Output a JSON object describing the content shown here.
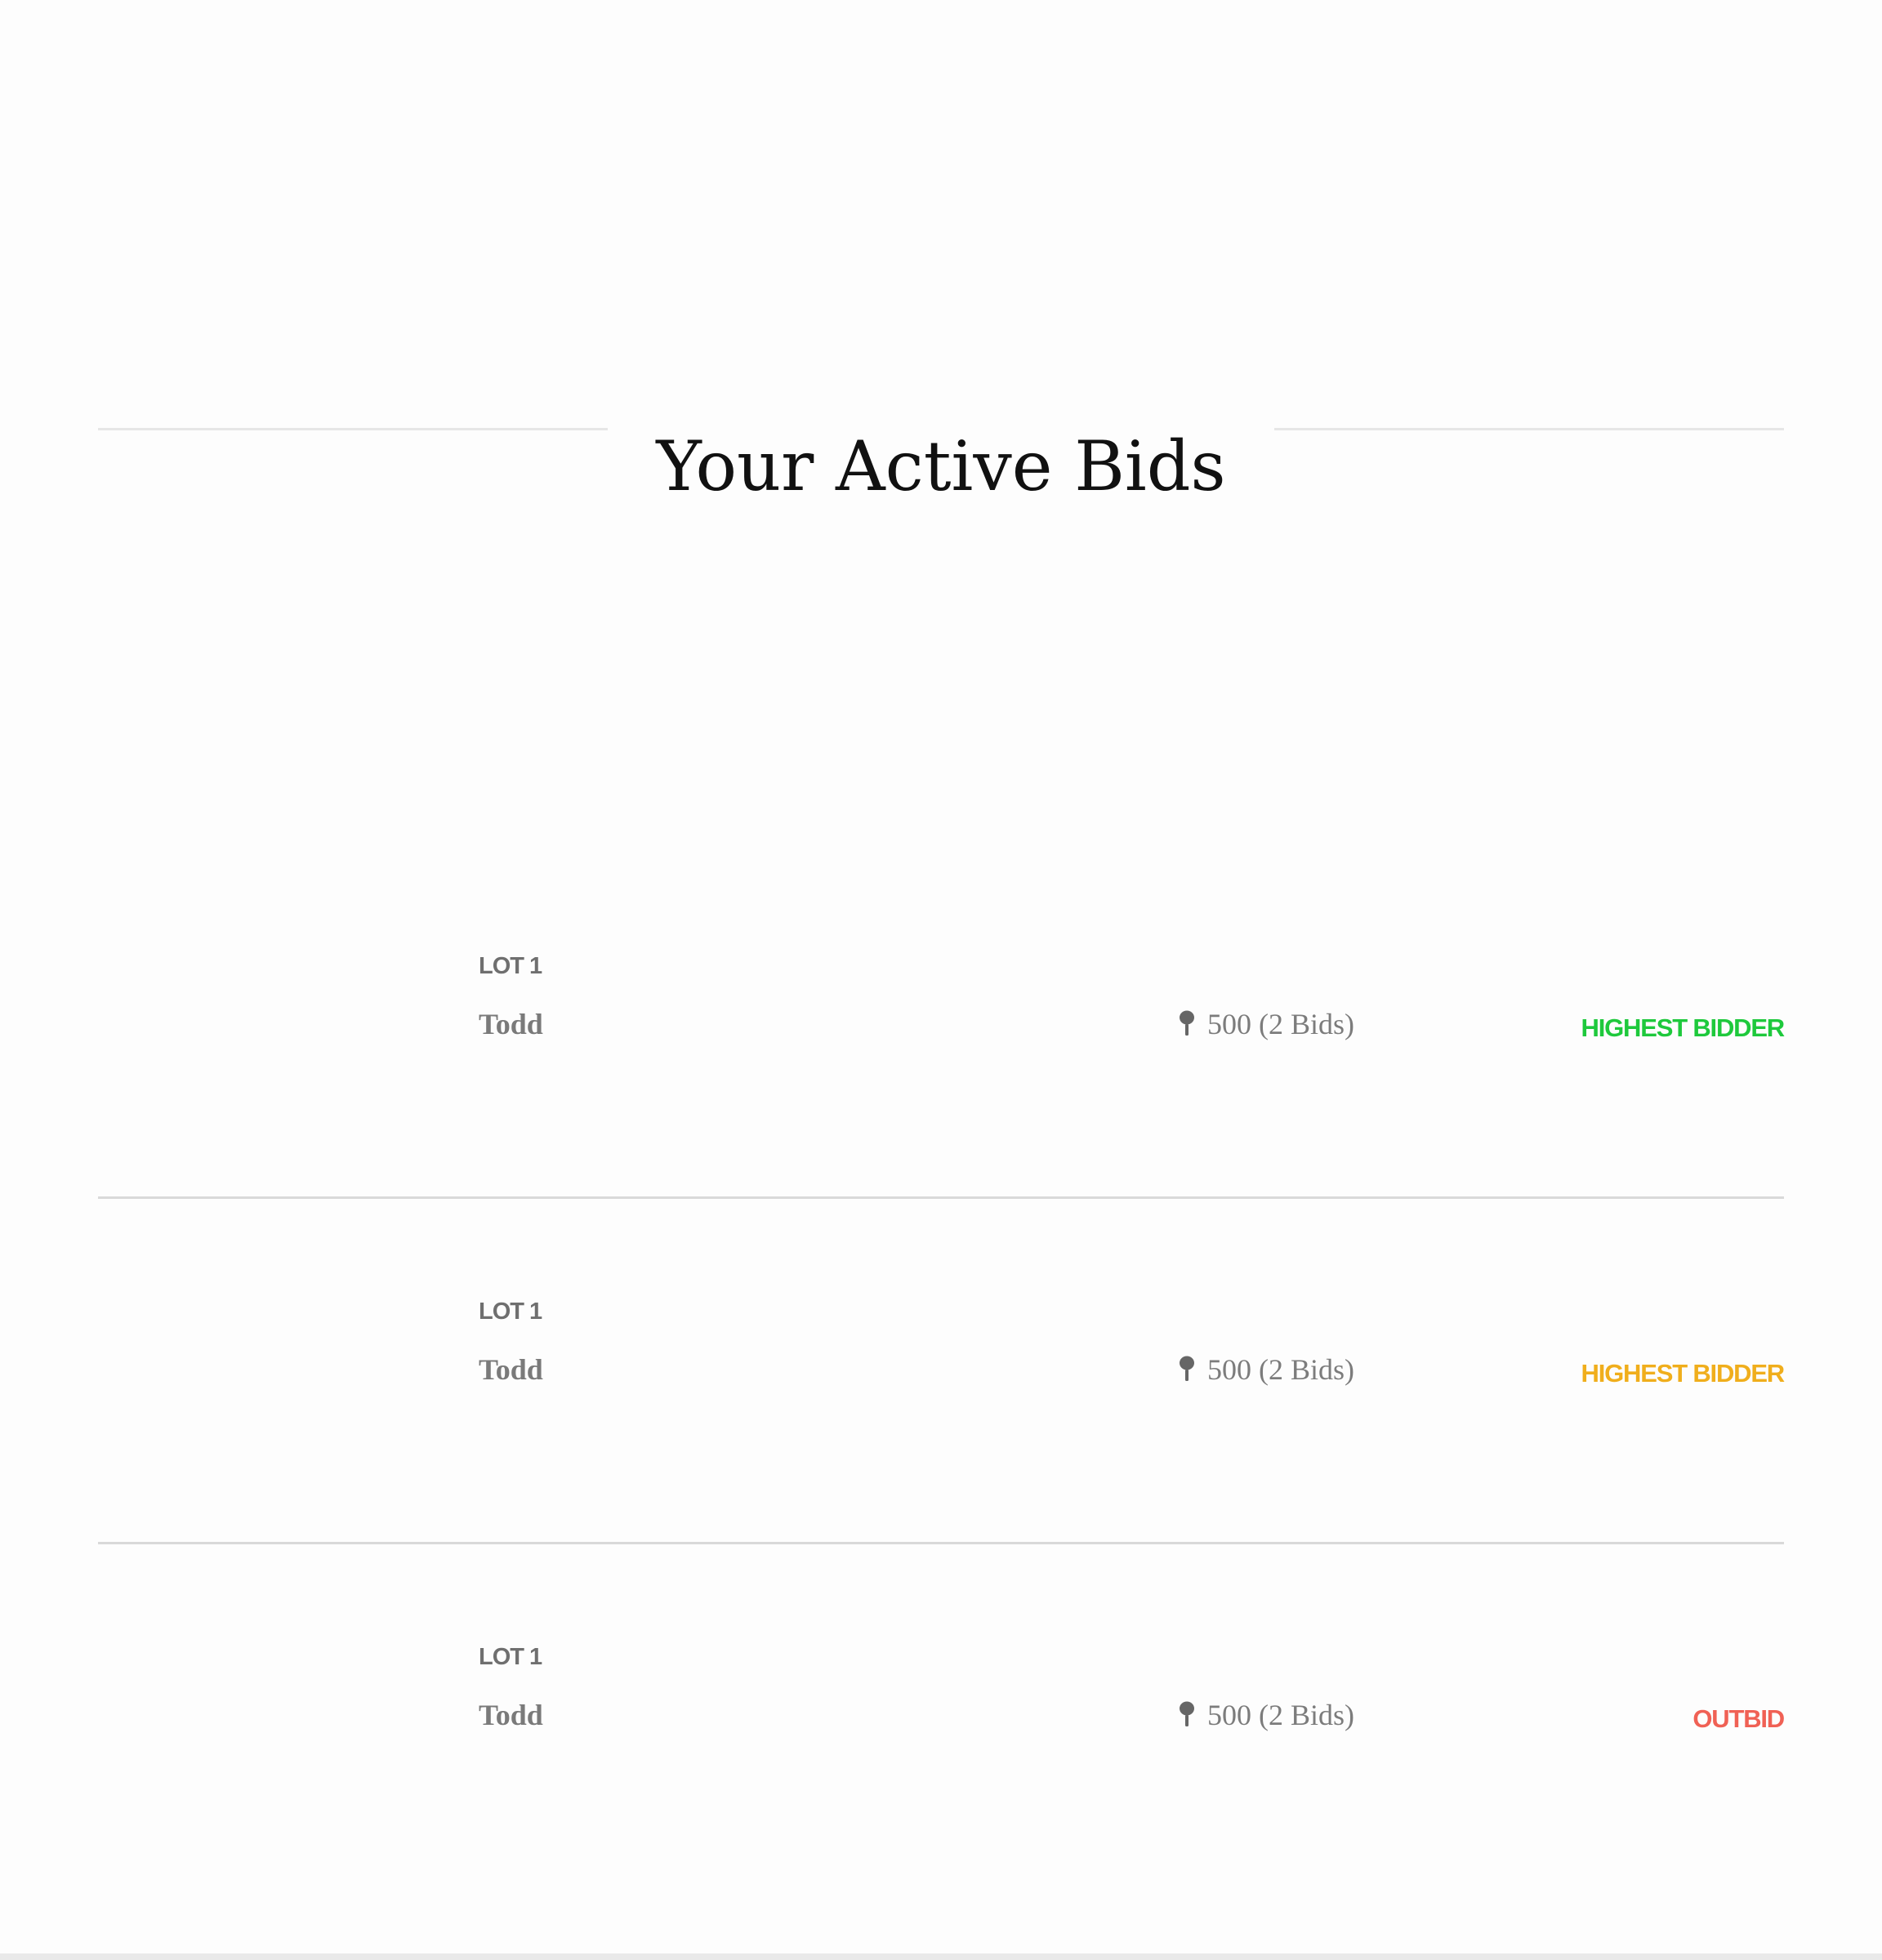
{
  "page": {
    "title": "Your Active Bids"
  },
  "bids": [
    {
      "lot": "LOT 1",
      "name": "Todd",
      "bid_text": "500 (2 Bids)",
      "status": "HIGHEST BIDDER",
      "status_color": "#1ec93c",
      "icon": "auction-paddle-icon"
    },
    {
      "lot": "LOT 1",
      "name": "Todd",
      "bid_text": "500 (2 Bids)",
      "status": "HIGHEST BIDDER",
      "status_color": "#f0ae1c",
      "icon": "auction-paddle-icon"
    },
    {
      "lot": "LOT 1",
      "name": "Todd",
      "bid_text": "500 (2 Bids)",
      "status": "OUTBID",
      "status_color": "#f06155",
      "icon": "auction-paddle-icon"
    }
  ]
}
